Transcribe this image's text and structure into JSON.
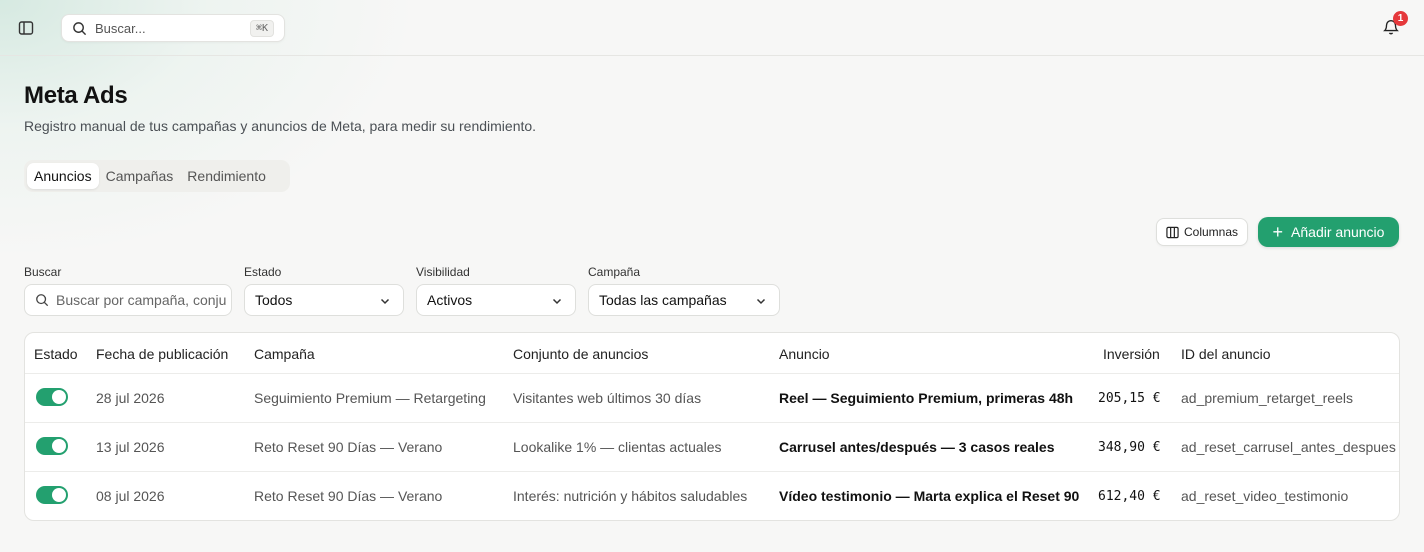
{
  "header": {
    "search_placeholder": "Buscar...",
    "search_shortcut": "⌘K",
    "notifications_count": "1"
  },
  "page": {
    "title": "Meta Ads",
    "subtitle": "Registro manual de tus campañas y anuncios de Meta, para medir su rendimiento."
  },
  "tabs": [
    {
      "label": "Anuncios",
      "active": true
    },
    {
      "label": "Campañas",
      "active": false
    },
    {
      "label": "Rendimiento",
      "active": false
    }
  ],
  "actions": {
    "columns_label": "Columnas",
    "add_label": "Añadir anuncio"
  },
  "filters": {
    "search": {
      "label": "Buscar",
      "placeholder": "Buscar por campaña, conjunto o anuncio"
    },
    "status": {
      "label": "Estado",
      "value": "Todos"
    },
    "visibility": {
      "label": "Visibilidad",
      "value": "Activos"
    },
    "campaign": {
      "label": "Campaña",
      "value": "Todas las campañas"
    }
  },
  "table": {
    "columns": [
      "Estado",
      "Fecha de publicación",
      "Campaña",
      "Conjunto de anuncios",
      "Anuncio",
      "Inversión",
      "ID del anuncio"
    ],
    "rows": [
      {
        "active": true,
        "date": "28 jul 2026",
        "campaign": "Seguimiento Premium — Retargeting",
        "adset": "Visitantes web últimos 30 días",
        "ad": "Reel — Seguimiento Premium, primeras 48h",
        "spend": "205,15 €",
        "ad_id": "ad_premium_retarget_reels"
      },
      {
        "active": true,
        "date": "13 jul 2026",
        "campaign": "Reto Reset 90 Días — Verano",
        "adset": "Lookalike 1% — clientas actuales",
        "ad": "Carrusel antes/después — 3 casos reales",
        "spend": "348,90 €",
        "ad_id": "ad_reset_carrusel_antes_despues"
      },
      {
        "active": true,
        "date": "08 jul 2026",
        "campaign": "Reto Reset 90 Días — Verano",
        "adset": "Interés: nutrición y hábitos saludables",
        "ad": "Vídeo testimonio — Marta explica el Reset 90",
        "spend": "612,40 €",
        "ad_id": "ad_reset_video_testimonio"
      }
    ]
  },
  "colors": {
    "accent": "#23a06f",
    "badge": "#e5383b"
  }
}
